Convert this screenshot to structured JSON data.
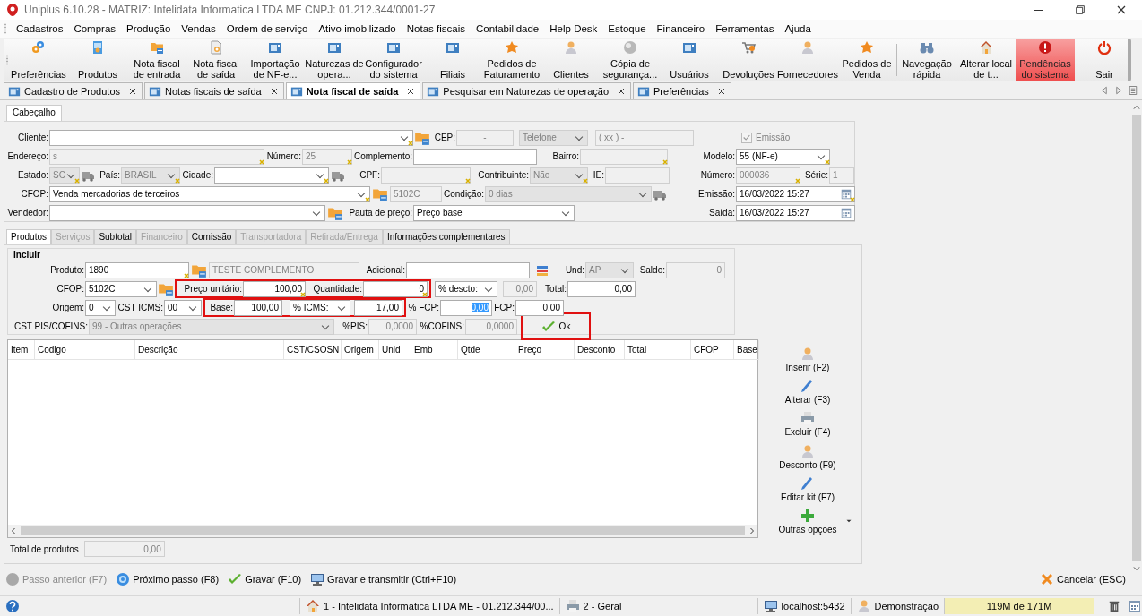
{
  "window": {
    "title": "Uniplus 6.10.28 - MATRIZ: Intelidata Informatica LTDA ME CNPJ: 01.212.344/0001-27"
  },
  "menu": [
    "Cadastros",
    "Compras",
    "Produção",
    "Vendas",
    "Ordem de serviço",
    "Ativo imobilizado",
    "Notas fiscais",
    "Contabilidade",
    "Help Desk",
    "Estoque",
    "Financeiro",
    "Ferramentas",
    "Ajuda"
  ],
  "toolbar": [
    {
      "label": "Preferências",
      "alert": false
    },
    {
      "label": "Produtos",
      "alert": false
    },
    {
      "label": "Nota fiscal de entrada",
      "alert": false
    },
    {
      "label": "Nota fiscal de saída",
      "alert": false
    },
    {
      "label": "Importação de NF-e...",
      "alert": false
    },
    {
      "label": "Naturezas de opera...",
      "alert": false
    },
    {
      "label": "Configurador do sistema",
      "alert": false
    },
    {
      "label": "Filiais",
      "alert": false
    },
    {
      "label": "Pedidos de Faturamento",
      "alert": false
    },
    {
      "label": "Clientes",
      "alert": false
    },
    {
      "label": "Cópia de segurança...",
      "alert": false
    },
    {
      "label": "Usuários",
      "alert": false
    },
    {
      "label": "Devoluções",
      "alert": false
    },
    {
      "label": "Fornecedores",
      "alert": false
    },
    {
      "label": "Pedidos de Venda",
      "alert": false
    },
    {
      "label": "Navegação rápida",
      "alert": false
    },
    {
      "label": "Alterar local de t...",
      "alert": false
    },
    {
      "label": "Pendências do sistema",
      "alert": true
    },
    {
      "label": "Sair",
      "alert": false
    }
  ],
  "doc_tabs": [
    {
      "label": "Cadastro de Produtos",
      "selected": false
    },
    {
      "label": "Notas fiscais de saída",
      "selected": false
    },
    {
      "label": "Nota fiscal de saída",
      "selected": true
    },
    {
      "label": "Pesquisar em Naturezas de operação",
      "selected": false
    },
    {
      "label": "Preferências",
      "selected": false
    }
  ],
  "form_tabs": [
    {
      "label": "Cabeçalho",
      "selected": true
    }
  ],
  "header": {
    "cliente": {
      "label": "Cliente:",
      "disabled": false,
      "required": true
    },
    "cep": {
      "label": "CEP:",
      "value": "-",
      "disabled": true
    },
    "phone_type": {
      "value": "Telefone",
      "disabled": true
    },
    "phone": {
      "value": "( xx )   -",
      "disabled": true
    },
    "emissao_check": {
      "label": "Emissão",
      "checked": true,
      "disabled": true
    },
    "endereco": {
      "label": "Endereço:",
      "value": "s",
      "disabled": true,
      "required": true
    },
    "numero": {
      "label": "Número:",
      "value": "25",
      "disabled": true,
      "required": true
    },
    "complemento": {
      "label": "Complemento:",
      "disabled": false
    },
    "bairro": {
      "label": "Bairro:",
      "disabled": true,
      "required": true
    },
    "modelo": {
      "label": "Modelo:",
      "value": "55  (NF-e)",
      "disabled": false,
      "required": true
    },
    "estado": {
      "label": "Estado:",
      "value": "SC",
      "disabled": true,
      "required": true
    },
    "pais": {
      "label": "País:",
      "value": "BRASIL",
      "disabled": true,
      "required": true
    },
    "cidade": {
      "label": "Cidade:",
      "disabled": false,
      "required": true
    },
    "cpf": {
      "label": "CPF:",
      "disabled": true,
      "required": true
    },
    "contribuinte": {
      "label": "Contribuinte:",
      "value": "Não",
      "disabled": true,
      "required": true
    },
    "ie": {
      "label": "IE:",
      "disabled": true
    },
    "numero_nf": {
      "label": "Número:",
      "value": "000036",
      "disabled": true,
      "required": true
    },
    "serie": {
      "label": "Série:",
      "value": "1",
      "disabled": true
    },
    "cfop": {
      "label": "CFOP:",
      "value": "Venda mercadorias de terceiros",
      "disabled": false,
      "required": true
    },
    "cfop_code": {
      "value": "5102C",
      "disabled": true
    },
    "condicao": {
      "label": "Condição:",
      "value": "0 dias",
      "disabled": true
    },
    "emissao": {
      "label": "Emissão:",
      "value": "16/03/2022 15:27",
      "disabled": false,
      "required": true
    },
    "vendedor": {
      "label": "Vendedor:",
      "disabled": false
    },
    "pauta": {
      "label": "Pauta de preço:",
      "value": "Preço base",
      "disabled": false
    },
    "saida": {
      "label": "Saída:",
      "value": "16/03/2022 15:27",
      "disabled": false
    }
  },
  "inner_tabs": [
    {
      "label": "Produtos",
      "selected": true,
      "disabled": false
    },
    {
      "label": "Serviços",
      "selected": false,
      "disabled": true
    },
    {
      "label": "Subtotal",
      "selected": false,
      "disabled": false
    },
    {
      "label": "Financeiro",
      "selected": false,
      "disabled": true
    },
    {
      "label": "Comissão",
      "selected": false,
      "disabled": false
    },
    {
      "label": "Transportadora",
      "selected": false,
      "disabled": true
    },
    {
      "label": "Retirada/Entrega",
      "selected": false,
      "disabled": true
    },
    {
      "label": "Informações complementares",
      "selected": false,
      "disabled": false
    }
  ],
  "include": {
    "title": "Incluir",
    "produto": {
      "label": "Produto:",
      "value": "1890",
      "disabled": false,
      "required": true
    },
    "descricao": {
      "value": "TESTE COMPLEMENTO",
      "disabled": true
    },
    "adicional": {
      "label": "Adicional:",
      "disabled": false
    },
    "und": {
      "label": "Und:",
      "value": "AP",
      "disabled": true
    },
    "saldo": {
      "label": "Saldo:",
      "value": "0",
      "disabled": true
    },
    "cfop": {
      "label": "CFOP:",
      "value": "5102C",
      "disabled": false
    },
    "price_group": {
      "highlighted": true,
      "preco": {
        "label": "Preço unitário:",
        "value": "100,00",
        "disabled": false,
        "required": true
      },
      "quantidade": {
        "label": "Quantidade:",
        "value": "0",
        "disabled": false,
        "required": true
      }
    },
    "desconto_tipo": {
      "value": "% descto:",
      "disabled": false
    },
    "desconto": {
      "value": "0,00",
      "disabled": true
    },
    "total": {
      "label": "Total:",
      "value": "0,00",
      "disabled": false
    },
    "origem": {
      "label": "Origem:",
      "value": "0",
      "disabled": false
    },
    "cst_icms": {
      "label": "CST ICMS:",
      "value": "00",
      "disabled": false
    },
    "base_group": {
      "highlighted": true,
      "base": {
        "label": "Base:",
        "value": "100,00",
        "disabled": false
      },
      "icms_tipo": {
        "value": "% ICMS:",
        "disabled": false
      },
      "icms": {
        "value": "17,00",
        "disabled": false
      }
    },
    "fcp_pct": {
      "label": "% FCP:",
      "value": "0,00",
      "disabled": false,
      "text_selected": true
    },
    "fcp": {
      "label": "FCP:",
      "value": "0,00",
      "disabled": false
    },
    "pis_cofins": {
      "label": "CST PIS/COFINS:",
      "value": "99 - Outras operações",
      "disabled": true
    },
    "pis": {
      "label": "%PIS:",
      "value": "0,0000",
      "disabled": true
    },
    "cofins": {
      "label": "%COFINS:",
      "value": "0,0000",
      "disabled": true
    },
    "ok_button": {
      "label": "Ok",
      "highlighted": true
    }
  },
  "table": {
    "columns": [
      "Item",
      "Codigo",
      "Descrição",
      "CST/CSOSN",
      "Origem",
      "Unid",
      "Emb",
      "Qtde",
      "Preço",
      "Desconto",
      "Total",
      "CFOP",
      "Base"
    ]
  },
  "item_actions": [
    {
      "label": "Inserir (F2)"
    },
    {
      "label": "Alterar (F3)"
    },
    {
      "label": "Excluir (F4)"
    },
    {
      "label": "Desconto (F9)"
    },
    {
      "label": "Editar kit (F7)"
    },
    {
      "label": "Outras opções"
    }
  ],
  "totals": {
    "label": "Total de produtos",
    "value": "0,00"
  },
  "footer_actions": [
    {
      "label": "Passo anterior (F7)",
      "disabled": true
    },
    {
      "label": "Próximo passo (F8)",
      "disabled": false
    },
    {
      "label": "Gravar (F10)",
      "disabled": false
    },
    {
      "label": "Gravar e transmitir (Ctrl+F10)",
      "disabled": false
    }
  ],
  "cancel": {
    "label": "Cancelar (ESC)"
  },
  "status_bar": [
    {
      "text": "1 - Intelidata Informatica LTDA ME - 01.212.344/00..."
    },
    {
      "text": "2 - Geral"
    },
    {
      "text": "localhost:5432"
    },
    {
      "text": "Demonstração"
    },
    {
      "text": "119M de 171M"
    }
  ]
}
